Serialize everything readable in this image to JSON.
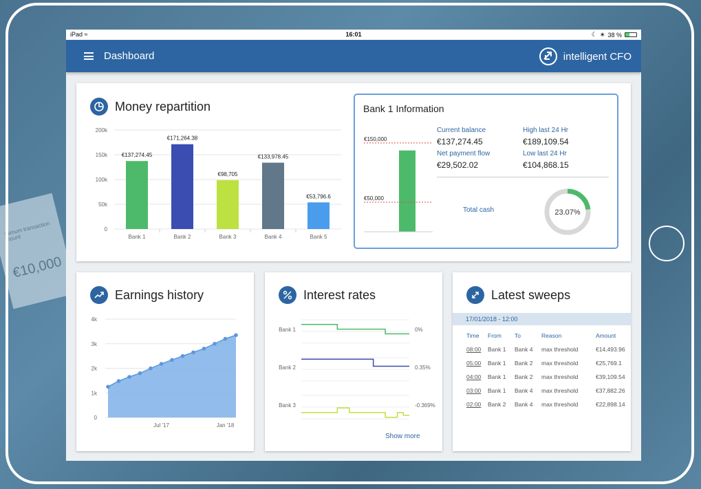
{
  "device_status": {
    "device": "iPad",
    "time": "16:01",
    "battery": "38 %",
    "battery_fraction": 0.38
  },
  "app_bar": {
    "title": "Dashboard",
    "brand": "intelligent CFO"
  },
  "money_repartition": {
    "title": "Money repartition",
    "chart_data": {
      "type": "bar",
      "title": "Money repartition",
      "categories": [
        "Bank 1",
        "Bank 2",
        "Bank 3",
        "Bank 4",
        "Bank 5"
      ],
      "values": [
        137274.45,
        171264.38,
        98705,
        133978.45,
        53796.6
      ],
      "value_labels": [
        "€137,274.45",
        "€171,264.38",
        "€98,705",
        "€133,978.45",
        "€53,796.6"
      ],
      "colors": [
        "#4cba6a",
        "#3b4db1",
        "#bde141",
        "#607889",
        "#4a9ced"
      ],
      "y_ticks": [
        "0",
        "50k",
        "100k",
        "150k",
        "200k"
      ],
      "ylim": [
        0,
        200000
      ],
      "grid": true
    }
  },
  "bank_info": {
    "title": "Bank 1 Information",
    "gauge": {
      "upper_label": "€150,000",
      "lower_label": "€50,000",
      "upper_value": 150000,
      "lower_value": 50000,
      "bar_value": 137274.45,
      "scale_max": 180000,
      "bar_color": "#4cba6a"
    },
    "current_balance_label": "Current balance",
    "current_balance": "€137,274.45",
    "high_label": "High last 24 Hr",
    "high_value": "€189,109.54",
    "net_flow_label": "Net payment flow",
    "net_flow": "€29,502.02",
    "low_label": "Low last 24 Hr",
    "low_value": "€104,868.15",
    "total_cash_label": "Total cash",
    "donut": {
      "label": "23.07%",
      "fraction": 0.2307,
      "color": "#4cba6a",
      "track_color": "#d8d8d8"
    }
  },
  "earnings_history": {
    "title": "Earnings history",
    "chart_data": {
      "type": "area",
      "title": "Earnings history",
      "y_ticks": [
        "0",
        "1k",
        "2k",
        "3k",
        "4k"
      ],
      "ylim": [
        0,
        4000
      ],
      "x_tick_labels": [
        "Jul '17",
        "Jan '18"
      ],
      "x_tick_positions": [
        5,
        11
      ],
      "x": [
        0,
        1,
        2,
        3,
        4,
        5,
        6,
        7,
        8,
        9,
        10,
        11,
        12
      ],
      "values": [
        1250,
        1480,
        1650,
        1800,
        2000,
        2180,
        2340,
        2500,
        2650,
        2800,
        3000,
        3200,
        3350
      ],
      "color": "#7fb0e8",
      "grid": true
    }
  },
  "interest_rates": {
    "title": "Interest rates",
    "show_more": "Show more",
    "chart_data": {
      "type": "line",
      "title": "Interest rates",
      "series": [
        {
          "name": "Bank 1",
          "end_label": "0%",
          "color": "#4cba6a",
          "values": [
            0.6,
            0.6,
            0.6,
            0.6,
            0.6,
            0.6,
            0.3,
            0.3,
            0.3,
            0.3,
            0.3,
            0.3,
            0.3,
            0.3,
            0,
            0,
            0,
            0
          ]
        },
        {
          "name": "Bank 2",
          "end_label": "0.35%",
          "color": "#3b4db1",
          "values": [
            0.8,
            0.8,
            0.8,
            0.8,
            0.8,
            0.8,
            0.8,
            0.8,
            0.8,
            0.8,
            0.8,
            0.8,
            0.35,
            0.35,
            0.35,
            0.35,
            0.35,
            0.35
          ]
        },
        {
          "name": "Bank 3",
          "end_label": "-0.369%",
          "color": "#bde141",
          "values": [
            -0.2,
            -0.2,
            -0.2,
            -0.2,
            -0.2,
            -0.2,
            0.1,
            0.1,
            -0.2,
            -0.2,
            -0.2,
            -0.2,
            -0.2,
            -0.2,
            -0.5,
            -0.5,
            -0.2,
            -0.37
          ]
        }
      ]
    }
  },
  "latest_sweeps": {
    "title": "Latest sweeps",
    "date_header": "17/01/2018 - 12:00",
    "columns": [
      "Time",
      "From",
      "To",
      "Reason",
      "Amount"
    ],
    "rows": [
      [
        "08:00",
        "Bank 1",
        "Bank 4",
        "max threshold",
        "€14,493.96"
      ],
      [
        "05:00",
        "Bank 1",
        "Bank 2",
        "max threshold",
        "€25,769.1"
      ],
      [
        "04:00",
        "Bank 1",
        "Bank 2",
        "max threshold",
        "€39,109.54"
      ],
      [
        "03:00",
        "Bank 1",
        "Bank 4",
        "max threshold",
        "€37,882.26"
      ],
      [
        "02:00",
        "Bank 2",
        "Bank 4",
        "max threshold",
        "€22,898.14"
      ]
    ]
  },
  "background": {
    "doc_amount": "€10,000",
    "doc_text_1": "inimum transaction",
    "doc_text_2": "mount"
  }
}
